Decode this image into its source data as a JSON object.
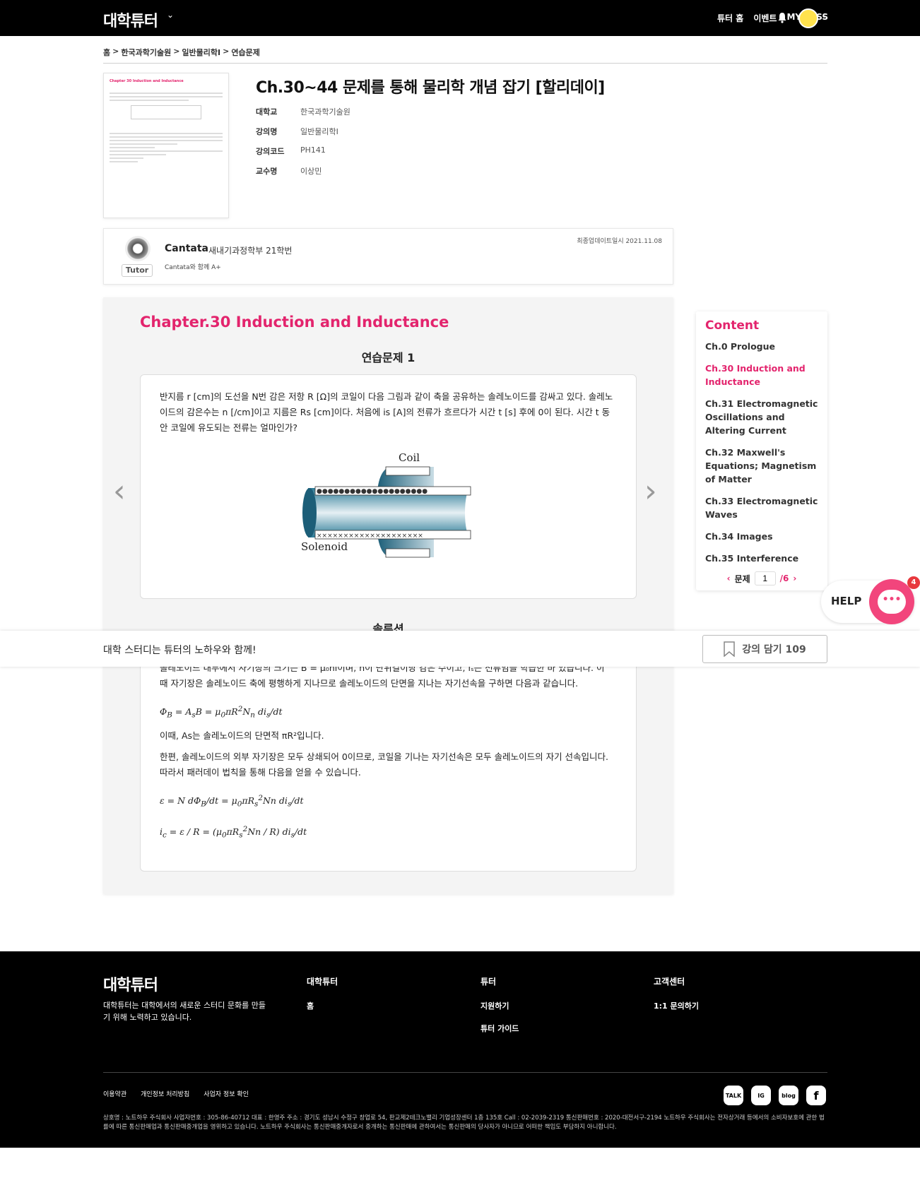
{
  "header": {
    "logo": "대학튜터",
    "nav": [
      "튜터 홈",
      "이벤트",
      "MY PASS"
    ]
  },
  "breadcrumb": [
    "홈",
    "한국과학기술원",
    "일반물리학Ⅰ",
    "연습문제"
  ],
  "course": {
    "title": "Ch.30~44 문제를 통해 물리학 개념 잡기 [할리데이]",
    "info": [
      {
        "key": "대학교",
        "value": "한국과학기술원"
      },
      {
        "key": "강의명",
        "value": "일반물리학Ⅰ"
      },
      {
        "key": "강의코드",
        "value": "PH141"
      },
      {
        "key": "교수명",
        "value": "이상민"
      }
    ],
    "thumbnail": {
      "title": "Chapter 30 Induction and Inductance"
    }
  },
  "tutor": {
    "name": "Cantata",
    "school": "새내기과정학부 21학번",
    "subtitle": "Cantata와 함께 A+",
    "badge": "Tutor",
    "updated": "최종업데이트일시 2021.11.08"
  },
  "content": {
    "chapter_title": "Chapter.30 Induction and Inductance",
    "problem_title": "연습문제 1",
    "problem_text": "반지름 r [cm]의 도선을 N번 감은 저항 R [Ω]의 코일이 다음 그림과 같이 축을 공유하는 솔레노이드를 감싸고 있다. 솔레노이드의 감은수는 n [/cm]이고 지름은 Rs [cm]이다. 처음에 is [A]의 전류가 흐르다가 시간 t [s] 후에 0이 된다. 시간 t 동안 코일에 유도되는 전류는 얼마인가?",
    "figure": {
      "coil_label": "Coil",
      "solenoid_label": "Solenoid"
    },
    "solution_title": "솔루션",
    "solution_lines": [
      "솔레노이드 내부에서 자기장의 크기는 B = μ₀ni이며, n이 단위길이당 감은 수이고, iₛ는 전류임을 학습한 바 있습니다. 이",
      "때 자기장은 솔레노이드 축에 평행하게 지나므로 솔레노이드의 단면을 지나는 자기선속을 구하면 다음과 같습니다.",
      "이때, As는 솔레노이드의 단면적 πR²입니다.",
      "한편, 솔레노이드의 외부 자기장은 모두 상쇄되어 0이므로, 코일을 기나는 자기선속은 모두 솔레노이드의 자기 선속입니다.",
      "따라서 패러데이 법칙을 통해 다음을 얻을 수 있습니다."
    ]
  },
  "sticky": {
    "text": "대학 스터디는 튜터의 노하우와 함께!",
    "save_label": "강의 담기 109"
  },
  "toc": {
    "heading": "Content",
    "items": [
      "Ch.0 Prologue",
      "Ch.30 Induction and Inductance",
      "Ch.31 Electromagnetic Oscillations and Altering Current",
      "Ch.32 Maxwell's Equations; Magnetism of Matter",
      "Ch.33 Electromagnetic Waves",
      "Ch.34 Images",
      "Ch.35 Interference"
    ],
    "active_index": 1,
    "pager_label": "문제",
    "current": "1",
    "total": "/6"
  },
  "help": {
    "label": "HELP",
    "count": "4"
  },
  "footer": {
    "logo": "대학튜터",
    "desc": "대학튜터는 대학에서의 새로운 스터디 문화를 만들기 위해 노력하고 있습니다.",
    "cols": [
      {
        "heading": "대학튜터",
        "items": [
          "홈"
        ]
      },
      {
        "heading": "튜터",
        "items": [
          "지원하기",
          "튜터 가이드"
        ]
      },
      {
        "heading": "고객센터",
        "items": [
          "1:1 문의하기"
        ]
      }
    ],
    "links": [
      "이용약관",
      "개인정보 처리방침",
      "사업자 정보 확인"
    ],
    "social": [
      "TALK",
      "IG",
      "blog",
      "f"
    ],
    "legal": "상호명 : 노트하우 주식회사 사업자번호 : 305-86-40712 대표 : 한영주 주소 : 경기도 성남시 수정구 창업로 54, 판교제2테크노밸리 기업성장센터 1층 135호 Call : 02-2039-2319 통신판매번호 : 2020-대전서구-2194 노트하우 주식회사는 전자상거래 등에서의 소비자보호에 관한 법률에 따른 통신판매업과 통신판매중개업을 영위하고 있습니다. 노트하우 주식회사는 통신판매중개자로서 중개하는 통신판매에 관하여서는 통신판매의 당사자가 아니므로 어떠한 책임도 부담하지 아니합니다."
  }
}
